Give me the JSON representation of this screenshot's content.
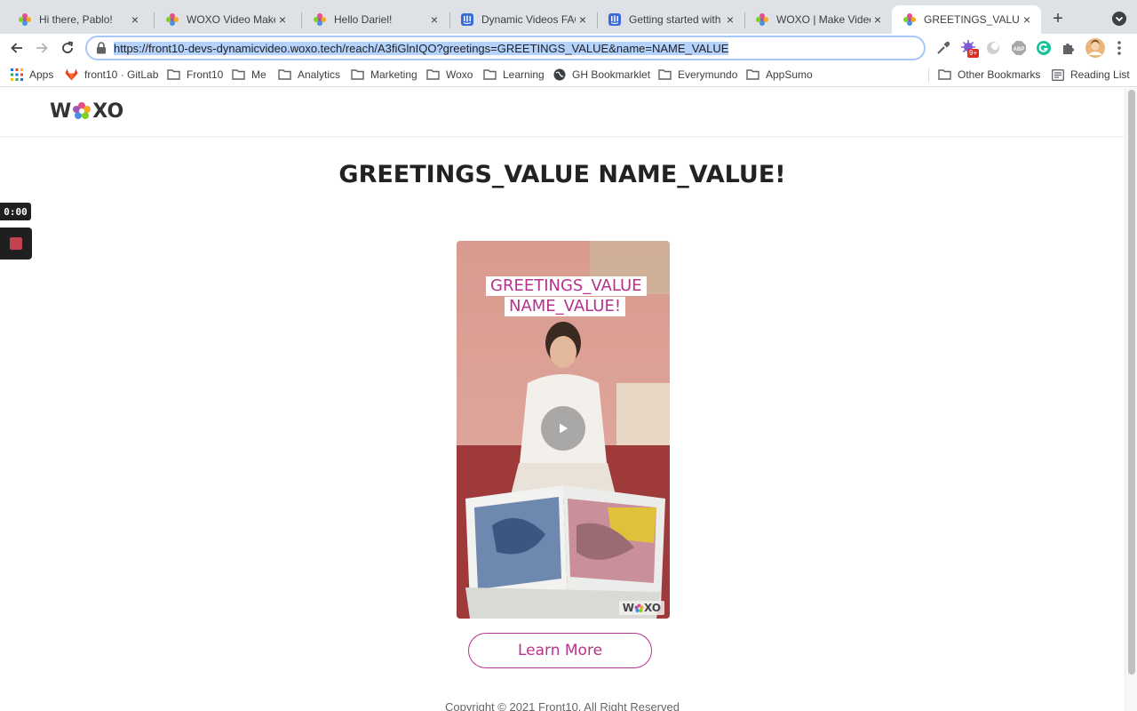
{
  "browser": {
    "tabs": [
      {
        "title": "Hi there, Pablo!",
        "favicon": "woxo-flower-icon"
      },
      {
        "title": "WOXO Video Maker |",
        "favicon": "woxo-flower-icon"
      },
      {
        "title": "Hello Dariel!",
        "favicon": "woxo-flower-icon"
      },
      {
        "title": "Dynamic Videos FAQ",
        "favicon": "intercom-icon"
      },
      {
        "title": "Getting started with D",
        "favicon": "intercom-icon"
      },
      {
        "title": "WOXO | Make Videos",
        "favicon": "woxo-flower-icon"
      },
      {
        "title": "GREETINGS_VALUE N",
        "favicon": "woxo-flower-icon",
        "active": true
      }
    ],
    "close_glyph": "×",
    "new_tab_glyph": "+",
    "url": "https://front10-devs-dynamicvideo.woxo.tech/reach/A3fiGlnIQO?greetings=GREETINGS_VALUE&name=NAME_VALUE",
    "extension_badge": "9+",
    "bookmarks": [
      {
        "label": "Apps",
        "icon": "apps-grid-icon"
      },
      {
        "label": "front10 · GitLab",
        "icon": "gitlab-icon"
      },
      {
        "label": "Front10",
        "icon": "folder-icon"
      },
      {
        "label": "Me",
        "icon": "folder-icon"
      },
      {
        "label": "Analytics",
        "icon": "folder-icon"
      },
      {
        "label": "Marketing",
        "icon": "folder-icon"
      },
      {
        "label": "Woxo",
        "icon": "folder-icon"
      },
      {
        "label": "Learning",
        "icon": "folder-icon"
      },
      {
        "label": "GH Bookmarklet",
        "icon": "globe-icon"
      },
      {
        "label": "Everymundo",
        "icon": "folder-icon"
      },
      {
        "label": "AppSumo",
        "icon": "folder-icon"
      }
    ],
    "other_bookmarks": "Other Bookmarks",
    "reading_list": "Reading List"
  },
  "page": {
    "logo_left": "W",
    "logo_right": "XO",
    "headline": "GREETINGS_VALUE NAME_VALUE!",
    "video": {
      "overlay_line1": "GREETINGS_VALUE",
      "overlay_line2": "NAME_VALUE!",
      "watermark_left": "W",
      "watermark_right": "XO"
    },
    "cta_label": "Learn More",
    "copyright": "Copyright © 2021 Front10. All Right Reserved"
  },
  "recorder": {
    "time": "0:00"
  },
  "colors": {
    "brand_pink": "#b5338a",
    "tab_strip": "#dee1e6",
    "url_selection": "#b4d2fb"
  }
}
